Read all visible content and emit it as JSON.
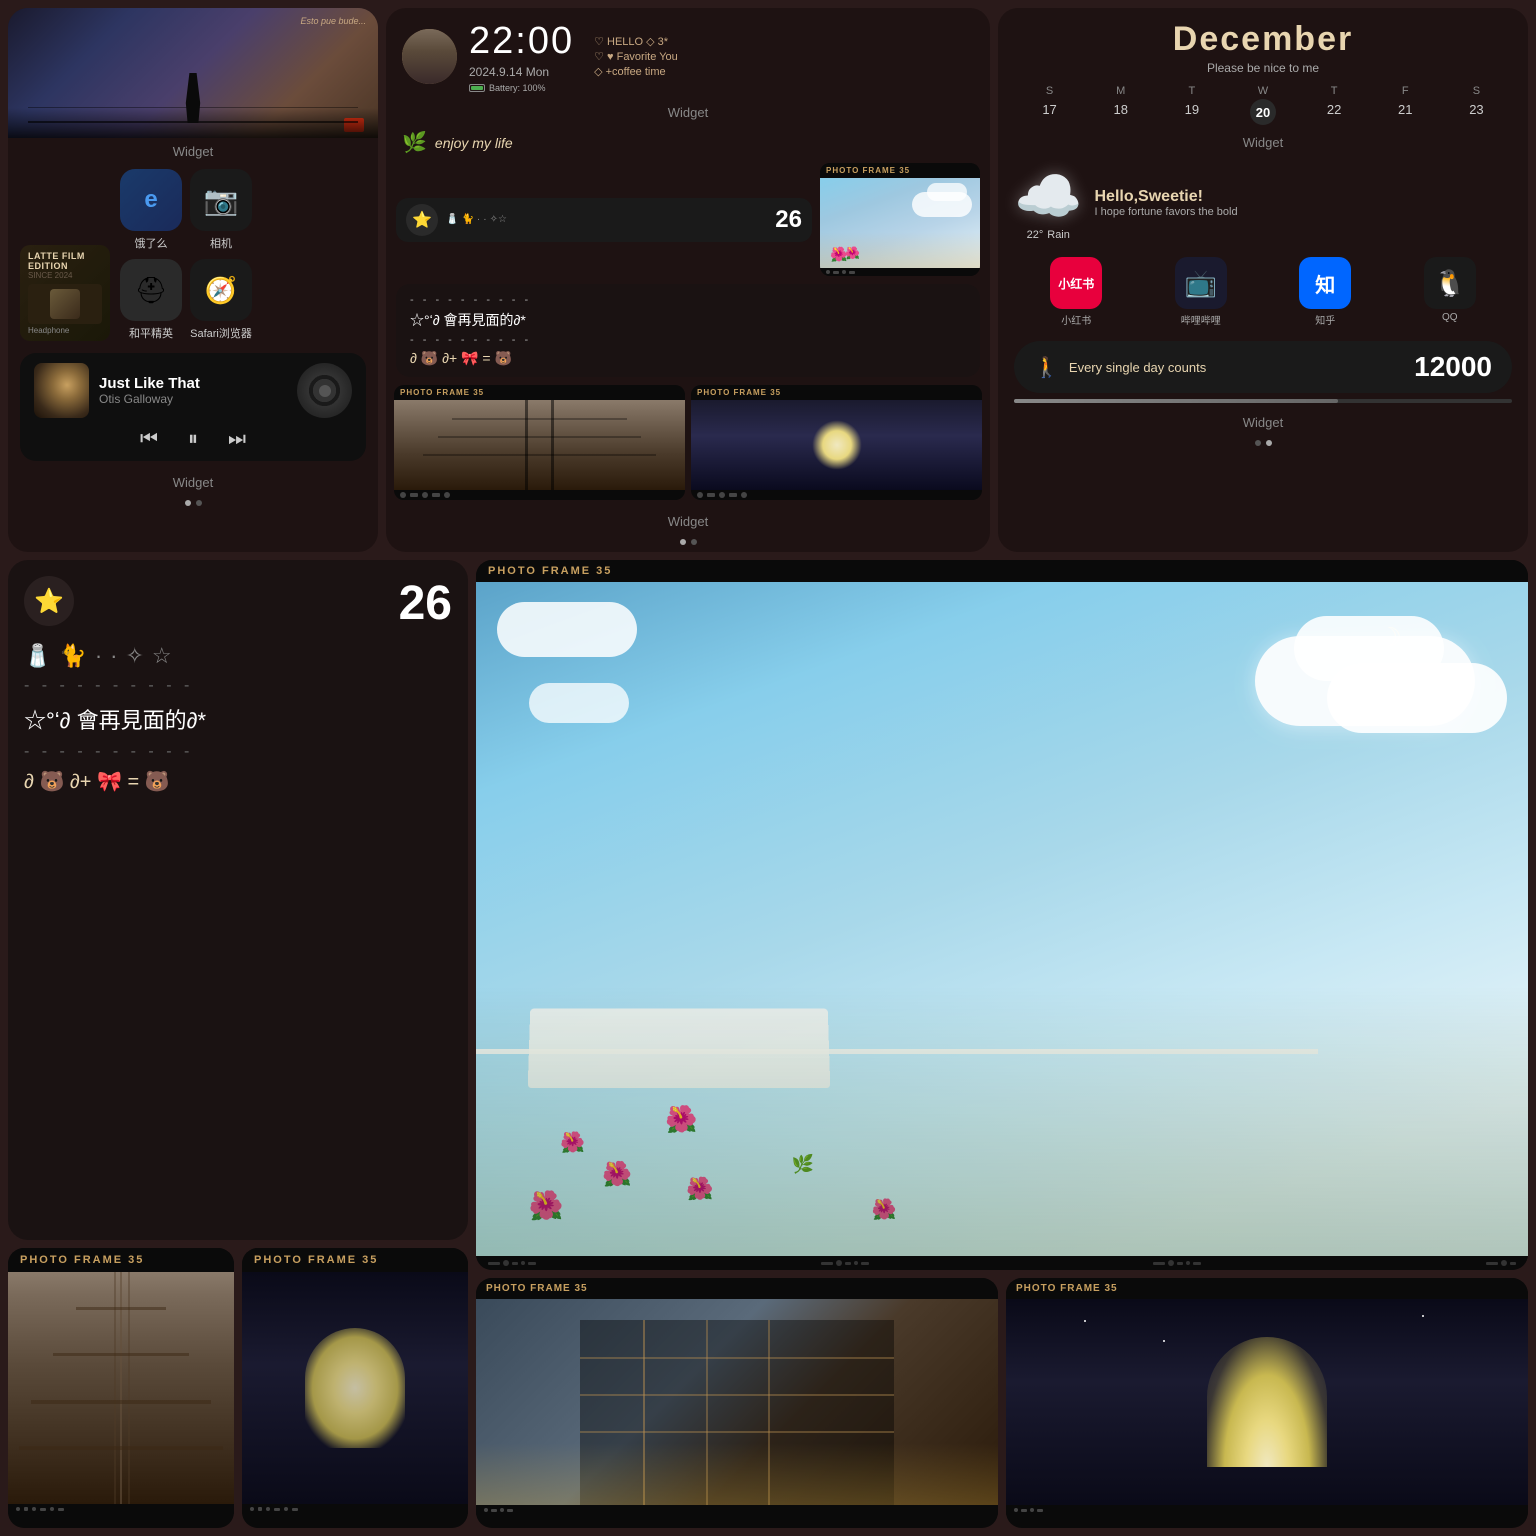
{
  "panels": {
    "left": {
      "widget_label": "Widget",
      "latte": {
        "title": "LATTE FILM EDITION",
        "subtitle": "SINCE 2024"
      },
      "apps": [
        {
          "name": "饿了么",
          "icon": "e",
          "color": "#1a1a1a"
        },
        {
          "name": "相机",
          "icon": "📷",
          "color": "#1a1a1a"
        },
        {
          "name": "和平精英",
          "icon": "⛑",
          "color": "#1a1a1a"
        },
        {
          "name": "Safari浏览器",
          "icon": "🧭",
          "color": "#1a1a1a"
        }
      ],
      "music": {
        "title": "Just Like That",
        "artist": "Otis Galloway"
      },
      "widget_label2": "Widget"
    },
    "center": {
      "time": "22:00",
      "date": "2024.9.14 Mon",
      "battery": "Battery: 100%",
      "status1": "♡ HELLO ◇ 3*",
      "status2": "♡ ♥ Favorite You",
      "status3": "◇ +coffee time",
      "widget_label": "Widget",
      "enjoy_text": "enjoy my life",
      "stats_number": "26",
      "photo_frame_label": "PHOTO FRAME 35",
      "chinese_main": "☆°ʻ∂ 會再見面的∂*",
      "equation": "∂ 🐻 ∂+ 🎀 = 🐻",
      "widget_label2": "Widget"
    },
    "right": {
      "month": "December",
      "subtitle": "Please be nice to me",
      "calendar": {
        "headers": [
          "S",
          "M",
          "T",
          "W",
          "T",
          "F",
          "S"
        ],
        "days": [
          "17",
          "18",
          "19",
          "20",
          "22",
          "21",
          "23"
        ]
      },
      "weather": {
        "greeting": "Hello,Sweetie!",
        "message": "I hope fortune favors the bold",
        "temp": "22°",
        "condition": "Rain"
      },
      "apps": [
        {
          "name": "小红书",
          "icon": "小红书",
          "style": "red-book"
        },
        {
          "name": "哔哩哔哩",
          "icon": "哔",
          "style": "bili"
        },
        {
          "name": "知乎",
          "icon": "知",
          "style": "zhihu"
        },
        {
          "name": "QQ",
          "icon": "Q",
          "style": "qq"
        }
      ],
      "steps": {
        "label": "Every single day counts",
        "count": "12000",
        "progress": 65
      },
      "widget_label": "Widget"
    }
  },
  "bottom": {
    "large_widget": {
      "number": "26",
      "emoji_row": "🧂 🐈 · ✧",
      "divider": "- - - - - - - - - -",
      "chinese_text": "☆°ʻ∂ 會再見面的∂*",
      "equation": "∂ 🐻 ∂+ 🎀 = 🐻"
    },
    "photo_frame_large": {
      "title": "PHOTO FRAME 35"
    },
    "photo_frames_bottom": [
      {
        "title": "PHOTO FRAME 35",
        "type": "train"
      },
      {
        "title": "PHOTO FRAME 35",
        "type": "moon"
      }
    ]
  },
  "nav_dots": {
    "top_left": [
      "inactive",
      "inactive"
    ],
    "top_right": [
      "inactive",
      "active"
    ],
    "bottom_left": [],
    "bottom_right": []
  }
}
